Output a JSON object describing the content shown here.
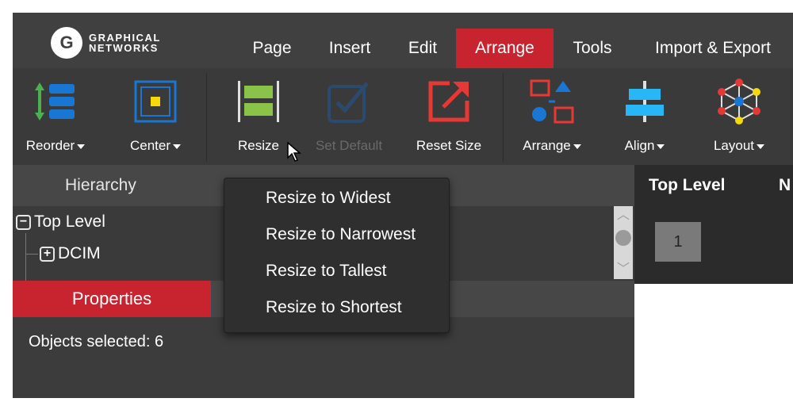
{
  "app": {
    "logo": {
      "mark": "G",
      "line1": "GRAPHICAL",
      "line2": "NETWORKS"
    },
    "menu": [
      {
        "label": "Page"
      },
      {
        "label": "Insert"
      },
      {
        "label": "Edit"
      },
      {
        "label": "Arrange",
        "active": true
      },
      {
        "label": "Tools"
      },
      {
        "label": "Import & Export"
      }
    ],
    "accent_color": "#c8242f"
  },
  "toolbar": {
    "reorder": {
      "label": "Reorder",
      "icon": "reorder-icon"
    },
    "center": {
      "label": "Center",
      "icon": "center-icon"
    },
    "resize": {
      "label": "Resize",
      "icon": "resize-icon"
    },
    "set_default": {
      "label": "Set Default",
      "icon": "set-default-icon",
      "disabled": true
    },
    "reset_size": {
      "label": "Reset Size",
      "icon": "reset-size-icon"
    },
    "arrange": {
      "label": "Arrange",
      "icon": "arrange-icon"
    },
    "align": {
      "label": "Align",
      "icon": "align-icon"
    },
    "layout": {
      "label": "Layout",
      "icon": "layout-icon"
    }
  },
  "resize_menu": {
    "items": [
      {
        "label": "Resize to Widest"
      },
      {
        "label": "Resize to Narrowest"
      },
      {
        "label": "Resize to Tallest"
      },
      {
        "label": "Resize to Shortest"
      }
    ]
  },
  "hierarchy": {
    "title": "Hierarchy",
    "tree": [
      {
        "label": "Top Level",
        "expander": "−"
      },
      {
        "label": "DCIM",
        "expander": "+"
      }
    ]
  },
  "properties": {
    "tab_label": "Properties",
    "hidden_tab_tail": "s",
    "objects_selected": "Objects selected: 6"
  },
  "right_panel": {
    "col1": "Top Level",
    "col2": "N",
    "cell_value": "1"
  }
}
